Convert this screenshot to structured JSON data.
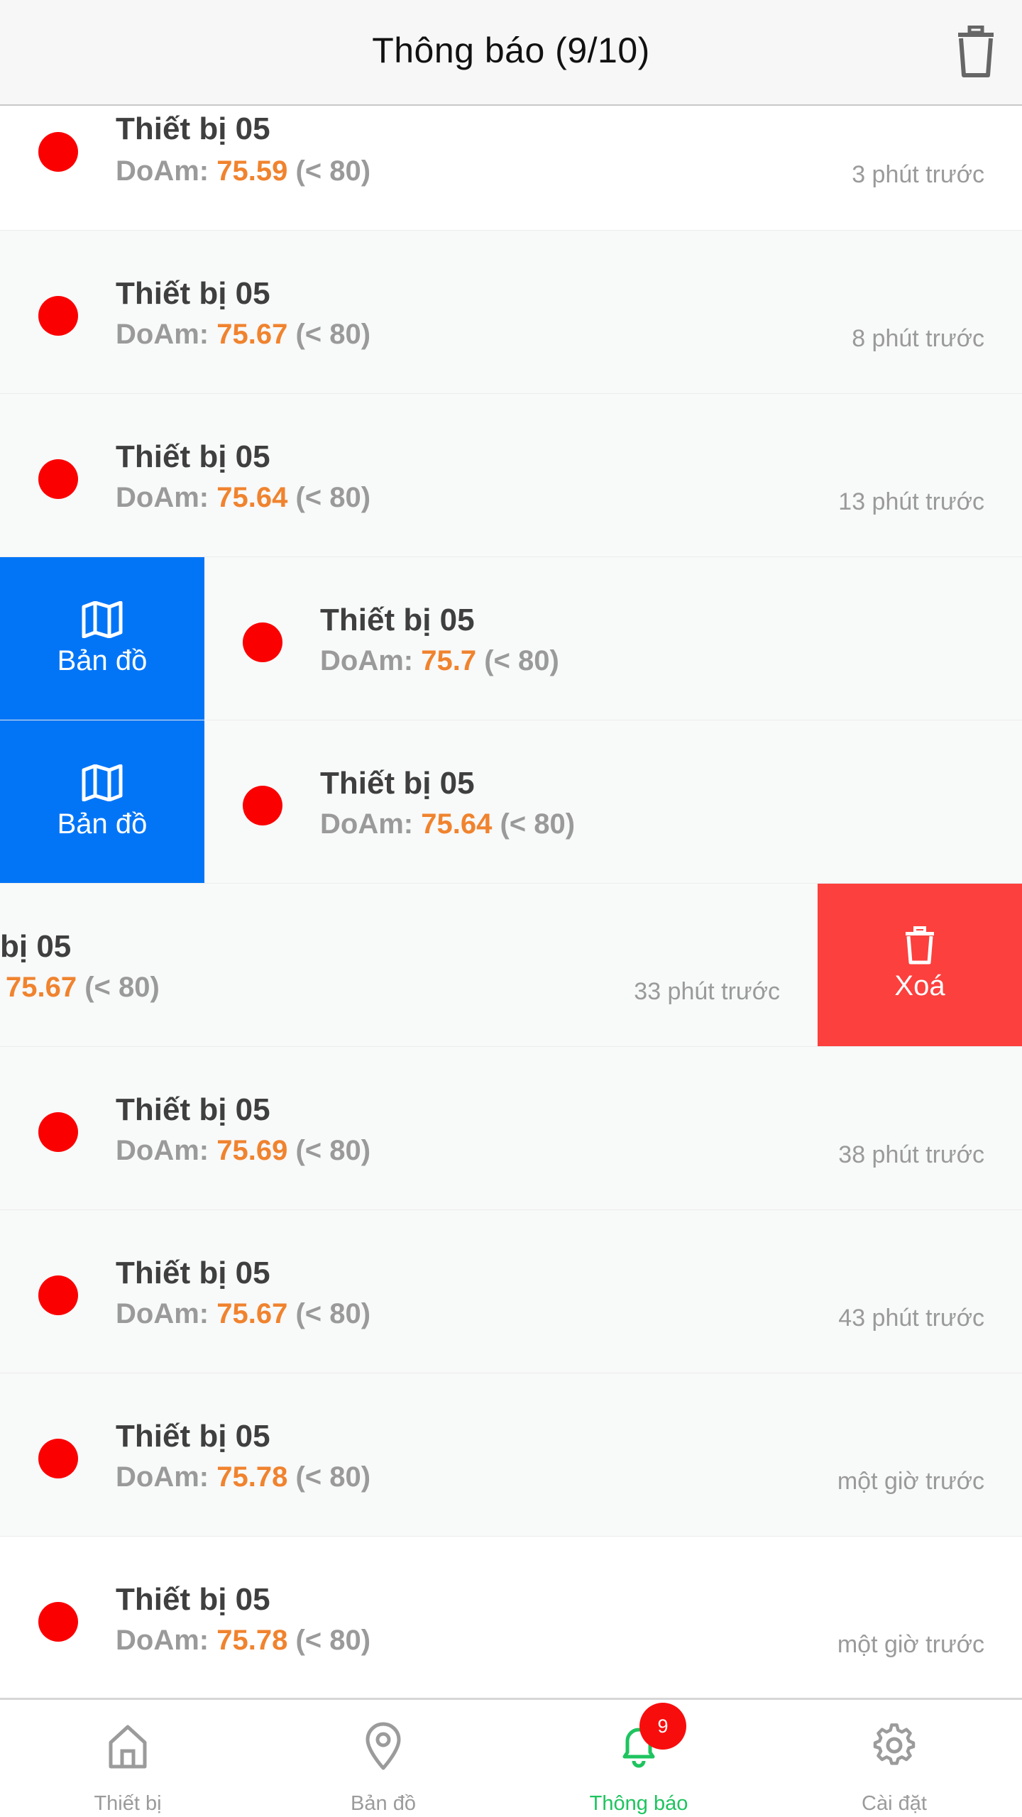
{
  "header": {
    "title": "Thông báo  (9/10)"
  },
  "notifications": [
    {
      "device": "Thiết bị 05",
      "metric": "DoAm:",
      "value": "75.59",
      "threshold": "(< 80)",
      "time": "3 phút trước"
    },
    {
      "device": "Thiết bị 05",
      "metric": "DoAm:",
      "value": "75.67",
      "threshold": "(< 80)",
      "time": "8 phút trước"
    },
    {
      "device": "Thiết bị 05",
      "metric": "DoAm:",
      "value": "75.64",
      "threshold": "(< 80)",
      "time": "13 phút trước"
    },
    {
      "device": "Thiết bị 05",
      "metric": "DoAm:",
      "value": "75.7",
      "threshold": "(< 80)",
      "time": "",
      "action": "Bản đồ"
    },
    {
      "device": "Thiết bị 05",
      "metric": "DoAm:",
      "value": "75.64",
      "threshold": "(< 80)",
      "time": "",
      "action": "Bản đồ"
    },
    {
      "device": "bị 05",
      "metric": "",
      "value": "75.67",
      "threshold": "(< 80)",
      "time": "33 phút trước",
      "action": "Xoá"
    },
    {
      "device": "Thiết bị 05",
      "metric": "DoAm:",
      "value": "75.69",
      "threshold": "(< 80)",
      "time": "38 phút trước"
    },
    {
      "device": "Thiết bị 05",
      "metric": "DoAm:",
      "value": "75.67",
      "threshold": "(< 80)",
      "time": "43 phút trước"
    },
    {
      "device": "Thiết bị 05",
      "metric": "DoAm:",
      "value": "75.78",
      "threshold": "(< 80)",
      "time": "một giờ trước"
    },
    {
      "device": "Thiết bị 05",
      "metric": "DoAm:",
      "value": "75.78",
      "threshold": "(< 80)",
      "time": "một giờ trước"
    }
  ],
  "nav": {
    "items": [
      {
        "label": "Thiết bị",
        "icon": "home-icon"
      },
      {
        "label": "Bản đồ",
        "icon": "map-pin-icon"
      },
      {
        "label": "Thông báo",
        "icon": "bell-icon"
      },
      {
        "label": "Cài đặt",
        "icon": "gear-icon"
      }
    ],
    "badge": "9",
    "active_color": "#1ec45f"
  },
  "colors": {
    "accent_blue": "#0275f7",
    "delete_red": "#fc403d",
    "alert_dot": "#fb0000",
    "value_orange": "#f0832e"
  }
}
